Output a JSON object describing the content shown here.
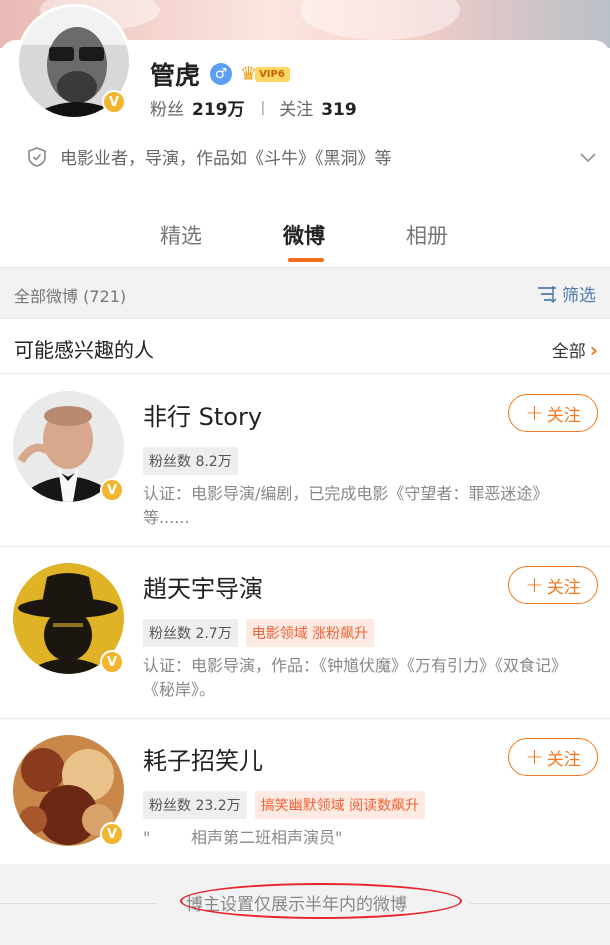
{
  "profile": {
    "name": "管虎",
    "vip_label": "VIP6",
    "verified_mark": "V",
    "gender_symbol": "♂",
    "followers_label": "粉丝",
    "followers_value": "219万",
    "following_label": "关注",
    "following_value": "319",
    "bio": "电影业者，导演，作品如《斗牛》《黑洞》等"
  },
  "tabs": [
    {
      "label": "精选",
      "active": false
    },
    {
      "label": "微博",
      "active": true
    },
    {
      "label": "相册",
      "active": false
    }
  ],
  "filter_bar": {
    "all_posts": "全部微博 (721)",
    "filter_label": "筛选"
  },
  "suggestions": {
    "title": "可能感兴趣的人",
    "see_all": "全部",
    "people": [
      {
        "name": "非行 Story",
        "follow_label": "关注",
        "fans_tag": "粉丝数 8.2万",
        "hot_tag": "",
        "description": "认证：电影导演/编剧，已完成电影《守望者：罪恶迷途》等......"
      },
      {
        "name": "趙天宇导演",
        "follow_label": "关注",
        "fans_tag": "粉丝数 2.7万",
        "hot_tag": "电影领域 涨粉飙升",
        "description": "认证：电影导演，作品：《钟馗伏魔》《万有引力》《双食记》《秘岸》。"
      },
      {
        "name": "耗子招笑儿",
        "follow_label": "关注",
        "fans_tag": "粉丝数 23.2万",
        "hot_tag": "搞笑幽默领域 阅读数飙升",
        "description": "\"        相声第二班相声演员\""
      }
    ]
  },
  "footer": {
    "note": "博主设置仅展示半年内的微博"
  },
  "colors": {
    "accent": "#f07a22",
    "verified": "#f4b52e",
    "link_blue": "#4f7cab",
    "annotation_red": "#e8232a"
  }
}
